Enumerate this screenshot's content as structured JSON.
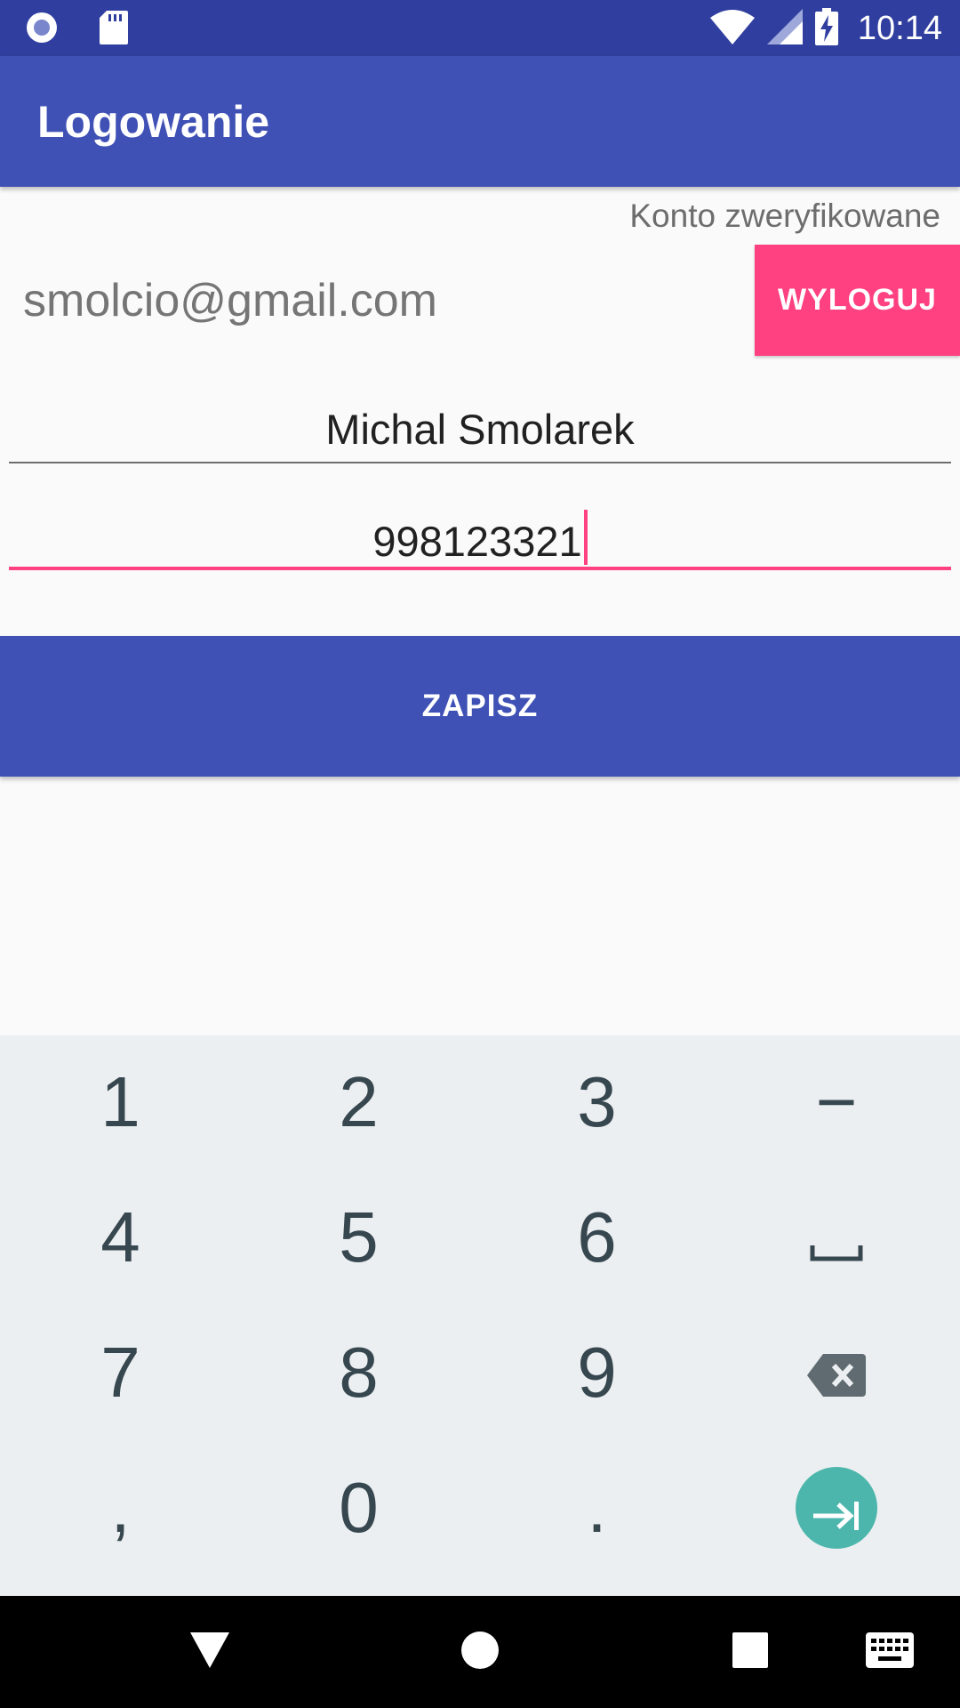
{
  "status_bar": {
    "time": "10:14"
  },
  "app_bar": {
    "title": "Logowanie"
  },
  "account": {
    "status": "Konto zweryfikowane",
    "email": "smolcio@gmail.com",
    "logout_label": "WYLOGUJ"
  },
  "form": {
    "name_value": "Michal Smolarek",
    "phone_value": "998123321",
    "save_label": "ZAPISZ"
  },
  "keyboard": {
    "row1": [
      "1",
      "2",
      "3",
      "−"
    ],
    "row2": [
      "4",
      "5",
      "6"
    ],
    "row3": [
      "7",
      "8",
      "9"
    ],
    "row4": [
      ",",
      "0",
      "."
    ]
  },
  "colors": {
    "primary": "#3f51b5",
    "primary_dark": "#303f9f",
    "accent": "#ff4081",
    "keyboard_bg": "#eceff1",
    "enter_key": "#4db6ac"
  },
  "icons": {
    "status_left": [
      "radio-icon",
      "sd-card-icon"
    ],
    "status_right": [
      "wifi-icon",
      "signal-icon",
      "battery-charging-icon"
    ],
    "keyboard_special": [
      "space-icon",
      "backspace-icon",
      "next-field-icon"
    ],
    "nav": [
      "back-icon",
      "home-icon",
      "recents-icon",
      "keyboard-switch-icon"
    ]
  }
}
